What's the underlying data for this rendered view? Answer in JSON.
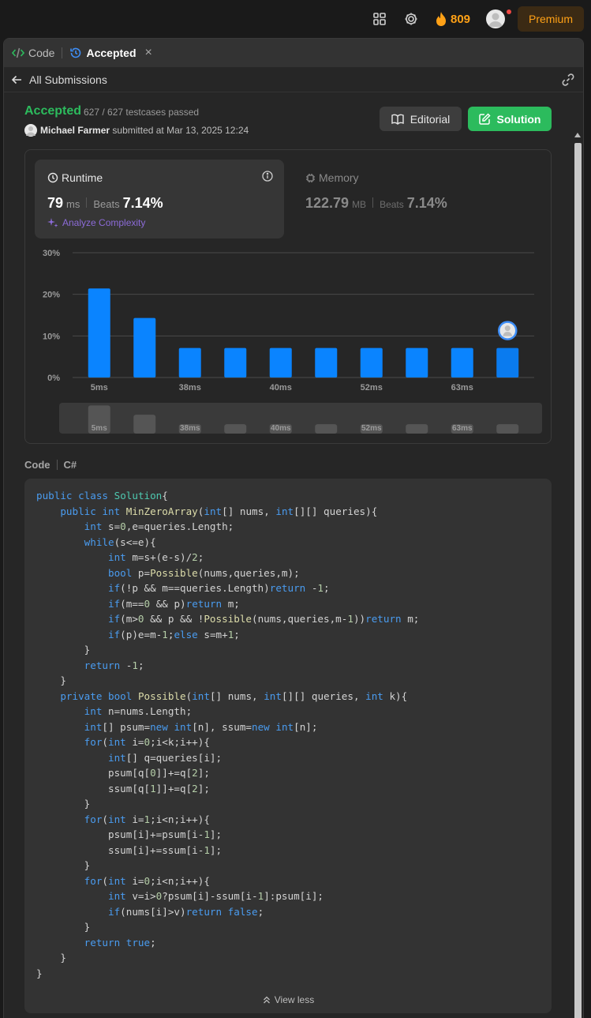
{
  "topbar": {
    "streak": "809",
    "premium_label": "Premium"
  },
  "tabs": [
    {
      "label": "Code"
    },
    {
      "label": "Accepted"
    }
  ],
  "subheader": {
    "back_label": "All Submissions"
  },
  "submission": {
    "status": "Accepted",
    "testcases": "627 / 627 testcases passed",
    "author": "Michael Farmer",
    "submitted": "submitted at Mar 13, 2025 12:24"
  },
  "buttons": {
    "editorial": "Editorial",
    "solution": "Solution"
  },
  "runtime": {
    "label": "Runtime",
    "value": "79",
    "unit": "ms",
    "beats_label": "Beats",
    "beats": "7.14%",
    "analyze_label": "Analyze Complexity"
  },
  "memory": {
    "label": "Memory",
    "value": "122.79",
    "unit": "MB",
    "beats_label": "Beats",
    "beats": "7.14%"
  },
  "chart_data": {
    "type": "bar",
    "ylim": [
      0,
      30
    ],
    "yticks": [
      "0%",
      "10%",
      "20%",
      "30%"
    ],
    "categories": [
      "5ms",
      "",
      "38ms",
      "",
      "40ms",
      "",
      "52ms",
      "",
      "63ms",
      ""
    ],
    "values": [
      21.4,
      14.3,
      7.1,
      7.1,
      7.1,
      7.1,
      7.1,
      7.1,
      7.1,
      7.1
    ],
    "user_bar_index": 9,
    "grid": true,
    "overview_labels": [
      "5ms",
      "38ms",
      "40ms",
      "52ms",
      "63ms"
    ]
  },
  "code": {
    "label": "Code",
    "language": "C#",
    "view_less": "View less"
  },
  "colors": {
    "accent_green": "#2cbb5d",
    "bar_blue": "#0a84ff",
    "streak_orange": "#ffa116"
  }
}
